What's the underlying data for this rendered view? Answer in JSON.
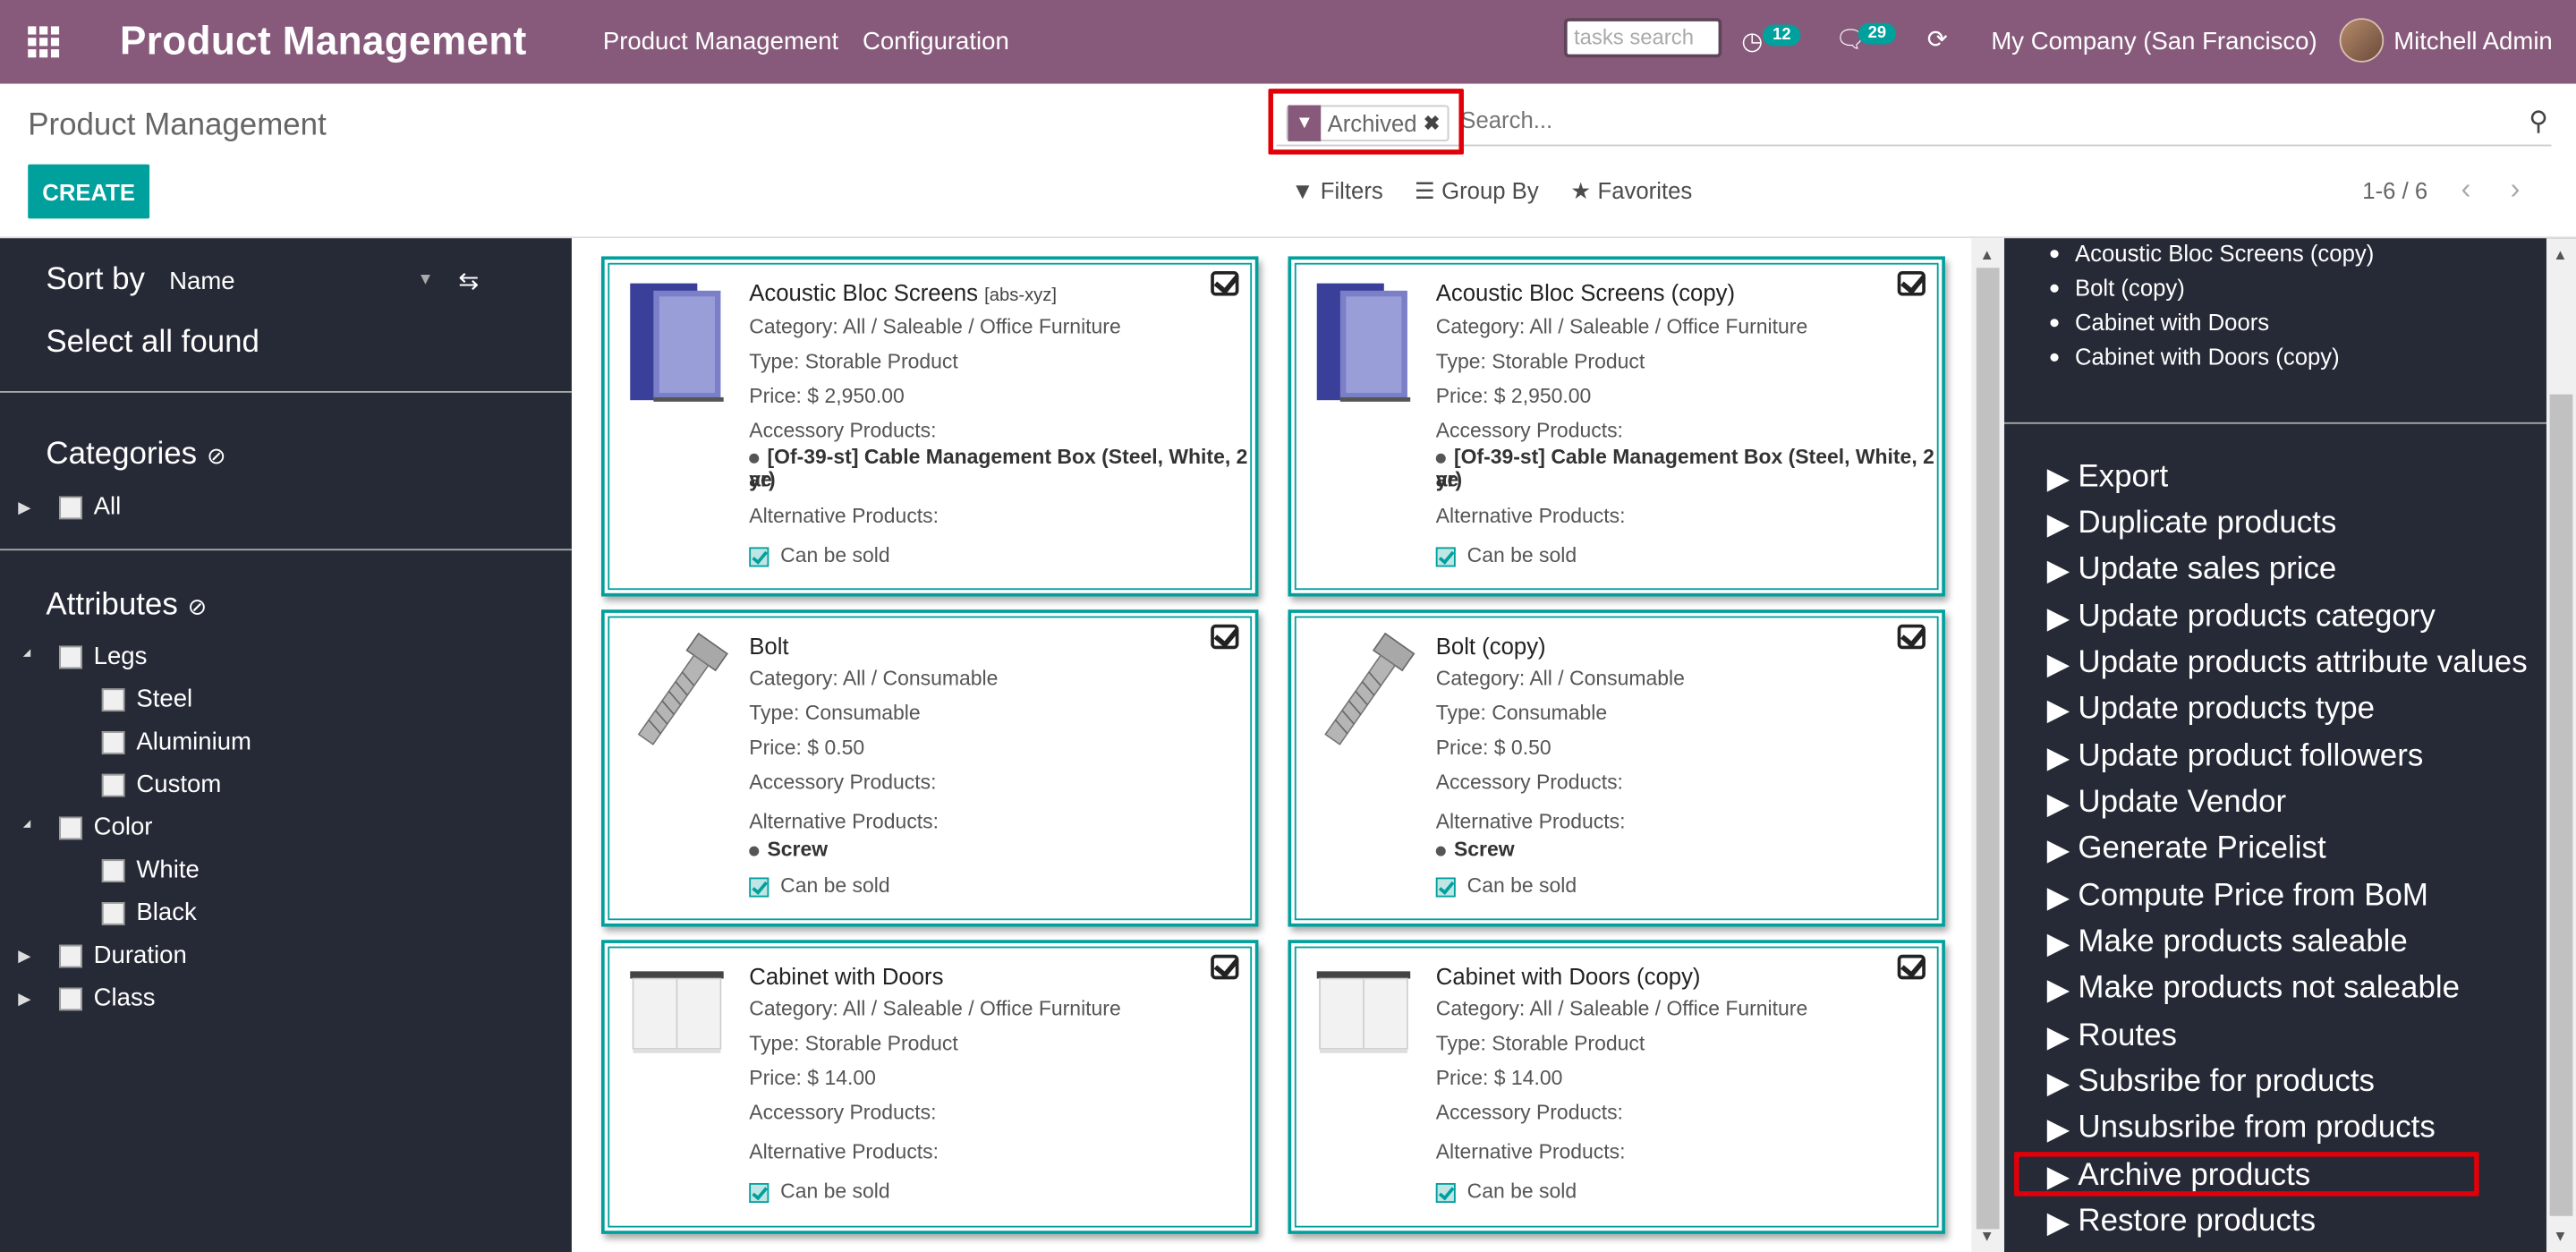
{
  "topbar": {
    "brand": "Product Management",
    "menu": [
      "Product Management",
      "Configuration"
    ],
    "task_search_placeholder": "tasks search",
    "activity_count": "12",
    "message_count": "29",
    "company": "My Company (San Francisco)",
    "user": "Mitchell Admin"
  },
  "control": {
    "title": "Product Management",
    "create_label": "CREATE",
    "facet_label": "Archived",
    "search_placeholder": "Search...",
    "filters_label": "Filters",
    "groupby_label": "Group By",
    "favorites_label": "Favorites",
    "pager": "1-6 / 6"
  },
  "sidebar": {
    "sort_label": "Sort by",
    "sort_value": "Name",
    "select_all": "Select all found",
    "categories_heading": "Categories",
    "categories": [
      "All"
    ],
    "attributes_heading": "Attributes",
    "attributes": [
      {
        "label": "Legs",
        "children": [
          "Steel",
          "Aluminium",
          "Custom"
        ]
      },
      {
        "label": "Color",
        "children": [
          "White",
          "Black"
        ]
      },
      {
        "label": "Duration",
        "children": []
      },
      {
        "label": "Class",
        "children": []
      }
    ]
  },
  "cards": [
    {
      "title": "Acoustic Bloc Screens",
      "ref": "[abs-xyz]",
      "category": "Category: All / Saleable / Office Furniture",
      "type": "Type: Storable Product",
      "price": "Price: $ 2,950.00",
      "accessory_label": "Accessory Products:",
      "accessory": "[Of-39-st] Cable Management Box (Steel, White, 2 ye",
      "accessory_wrap": "ar)",
      "alternative_label": "Alternative Products:",
      "alternative": "",
      "sold": "Can be sold"
    },
    {
      "title": "Acoustic Bloc Screens (copy)",
      "ref": "",
      "category": "Category: All / Saleable / Office Furniture",
      "type": "Type: Storable Product",
      "price": "Price: $ 2,950.00",
      "accessory_label": "Accessory Products:",
      "accessory": "[Of-39-st] Cable Management Box (Steel, White, 2 ye",
      "accessory_wrap": "ar)",
      "alternative_label": "Alternative Products:",
      "alternative": "",
      "sold": "Can be sold"
    },
    {
      "title": "Bolt",
      "ref": "",
      "category": "Category: All / Consumable",
      "type": "Type: Consumable",
      "price": "Price: $ 0.50",
      "accessory_label": "Accessory Products:",
      "accessory": "",
      "accessory_wrap": "",
      "alternative_label": "Alternative Products:",
      "alternative": "Screw",
      "sold": "Can be sold"
    },
    {
      "title": "Bolt (copy)",
      "ref": "",
      "category": "Category: All / Consumable",
      "type": "Type: Consumable",
      "price": "Price: $ 0.50",
      "accessory_label": "Accessory Products:",
      "accessory": "",
      "accessory_wrap": "",
      "alternative_label": "Alternative Products:",
      "alternative": "Screw",
      "sold": "Can be sold"
    },
    {
      "title": "Cabinet with Doors",
      "ref": "",
      "category": "Category: All / Saleable / Office Furniture",
      "type": "Type: Storable Product",
      "price": "Price: $ 14.00",
      "accessory_label": "Accessory Products:",
      "accessory": "",
      "accessory_wrap": "",
      "alternative_label": "Alternative Products:",
      "alternative": "",
      "sold": "Can be sold"
    },
    {
      "title": "Cabinet with Doors (copy)",
      "ref": "",
      "category": "Category: All / Saleable / Office Furniture",
      "type": "Type: Storable Product",
      "price": "Price: $ 14.00",
      "accessory_label": "Accessory Products:",
      "accessory": "",
      "accessory_wrap": "",
      "alternative_label": "Alternative Products:",
      "alternative": "",
      "sold": "Can be sold"
    }
  ],
  "right_panel": {
    "selected": [
      "Acoustic Bloc Screens (copy)",
      "Bolt (copy)",
      "Cabinet with Doors",
      "Cabinet with Doors (copy)"
    ],
    "actions": [
      "Export",
      "Duplicate products",
      "Update sales price",
      "Update products category",
      "Update products attribute values",
      "Update products type",
      "Update product followers",
      "Update Vendor",
      "Generate Pricelist",
      "Compute Price from BoM",
      "Make products saleable",
      "Make products not saleable",
      "Routes",
      "Subsribe for products",
      "Unsubsribe from products",
      "Archive products",
      "Restore products"
    ]
  },
  "colors": {
    "brand": "#875a7b",
    "accent": "#00a09d",
    "sidebar": "#262a36",
    "highlight": "#e10009"
  },
  "icons": [
    "apps-icon",
    "activity-icon",
    "chat-icon",
    "refresh-icon",
    "filter-icon",
    "close-icon",
    "search-icon",
    "sort-toggle-icon",
    "ban-icon",
    "caret-right-icon",
    "checkbox-icon",
    "triangle-right-icon"
  ]
}
